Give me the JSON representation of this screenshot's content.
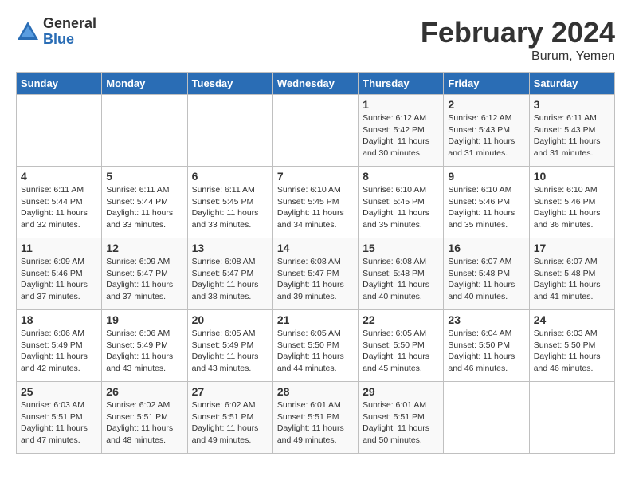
{
  "header": {
    "logo_general": "General",
    "logo_blue": "Blue",
    "title": "February 2024",
    "location": "Burum, Yemen"
  },
  "days_of_week": [
    "Sunday",
    "Monday",
    "Tuesday",
    "Wednesday",
    "Thursday",
    "Friday",
    "Saturday"
  ],
  "weeks": [
    [
      {
        "day": "",
        "info": ""
      },
      {
        "day": "",
        "info": ""
      },
      {
        "day": "",
        "info": ""
      },
      {
        "day": "",
        "info": ""
      },
      {
        "day": "1",
        "sunrise": "6:12 AM",
        "sunset": "5:42 PM",
        "daylight": "11 hours and 30 minutes."
      },
      {
        "day": "2",
        "sunrise": "6:12 AM",
        "sunset": "5:43 PM",
        "daylight": "11 hours and 31 minutes."
      },
      {
        "day": "3",
        "sunrise": "6:11 AM",
        "sunset": "5:43 PM",
        "daylight": "11 hours and 31 minutes."
      }
    ],
    [
      {
        "day": "4",
        "sunrise": "6:11 AM",
        "sunset": "5:44 PM",
        "daylight": "11 hours and 32 minutes."
      },
      {
        "day": "5",
        "sunrise": "6:11 AM",
        "sunset": "5:44 PM",
        "daylight": "11 hours and 33 minutes."
      },
      {
        "day": "6",
        "sunrise": "6:11 AM",
        "sunset": "5:45 PM",
        "daylight": "11 hours and 33 minutes."
      },
      {
        "day": "7",
        "sunrise": "6:10 AM",
        "sunset": "5:45 PM",
        "daylight": "11 hours and 34 minutes."
      },
      {
        "day": "8",
        "sunrise": "6:10 AM",
        "sunset": "5:45 PM",
        "daylight": "11 hours and 35 minutes."
      },
      {
        "day": "9",
        "sunrise": "6:10 AM",
        "sunset": "5:46 PM",
        "daylight": "11 hours and 35 minutes."
      },
      {
        "day": "10",
        "sunrise": "6:10 AM",
        "sunset": "5:46 PM",
        "daylight": "11 hours and 36 minutes."
      }
    ],
    [
      {
        "day": "11",
        "sunrise": "6:09 AM",
        "sunset": "5:46 PM",
        "daylight": "11 hours and 37 minutes."
      },
      {
        "day": "12",
        "sunrise": "6:09 AM",
        "sunset": "5:47 PM",
        "daylight": "11 hours and 37 minutes."
      },
      {
        "day": "13",
        "sunrise": "6:08 AM",
        "sunset": "5:47 PM",
        "daylight": "11 hours and 38 minutes."
      },
      {
        "day": "14",
        "sunrise": "6:08 AM",
        "sunset": "5:47 PM",
        "daylight": "11 hours and 39 minutes."
      },
      {
        "day": "15",
        "sunrise": "6:08 AM",
        "sunset": "5:48 PM",
        "daylight": "11 hours and 40 minutes."
      },
      {
        "day": "16",
        "sunrise": "6:07 AM",
        "sunset": "5:48 PM",
        "daylight": "11 hours and 40 minutes."
      },
      {
        "day": "17",
        "sunrise": "6:07 AM",
        "sunset": "5:48 PM",
        "daylight": "11 hours and 41 minutes."
      }
    ],
    [
      {
        "day": "18",
        "sunrise": "6:06 AM",
        "sunset": "5:49 PM",
        "daylight": "11 hours and 42 minutes."
      },
      {
        "day": "19",
        "sunrise": "6:06 AM",
        "sunset": "5:49 PM",
        "daylight": "11 hours and 43 minutes."
      },
      {
        "day": "20",
        "sunrise": "6:05 AM",
        "sunset": "5:49 PM",
        "daylight": "11 hours and 43 minutes."
      },
      {
        "day": "21",
        "sunrise": "6:05 AM",
        "sunset": "5:50 PM",
        "daylight": "11 hours and 44 minutes."
      },
      {
        "day": "22",
        "sunrise": "6:05 AM",
        "sunset": "5:50 PM",
        "daylight": "11 hours and 45 minutes."
      },
      {
        "day": "23",
        "sunrise": "6:04 AM",
        "sunset": "5:50 PM",
        "daylight": "11 hours and 46 minutes."
      },
      {
        "day": "24",
        "sunrise": "6:03 AM",
        "sunset": "5:50 PM",
        "daylight": "11 hours and 46 minutes."
      }
    ],
    [
      {
        "day": "25",
        "sunrise": "6:03 AM",
        "sunset": "5:51 PM",
        "daylight": "11 hours and 47 minutes."
      },
      {
        "day": "26",
        "sunrise": "6:02 AM",
        "sunset": "5:51 PM",
        "daylight": "11 hours and 48 minutes."
      },
      {
        "day": "27",
        "sunrise": "6:02 AM",
        "sunset": "5:51 PM",
        "daylight": "11 hours and 49 minutes."
      },
      {
        "day": "28",
        "sunrise": "6:01 AM",
        "sunset": "5:51 PM",
        "daylight": "11 hours and 49 minutes."
      },
      {
        "day": "29",
        "sunrise": "6:01 AM",
        "sunset": "5:51 PM",
        "daylight": "11 hours and 50 minutes."
      },
      {
        "day": "",
        "info": ""
      },
      {
        "day": "",
        "info": ""
      }
    ]
  ]
}
